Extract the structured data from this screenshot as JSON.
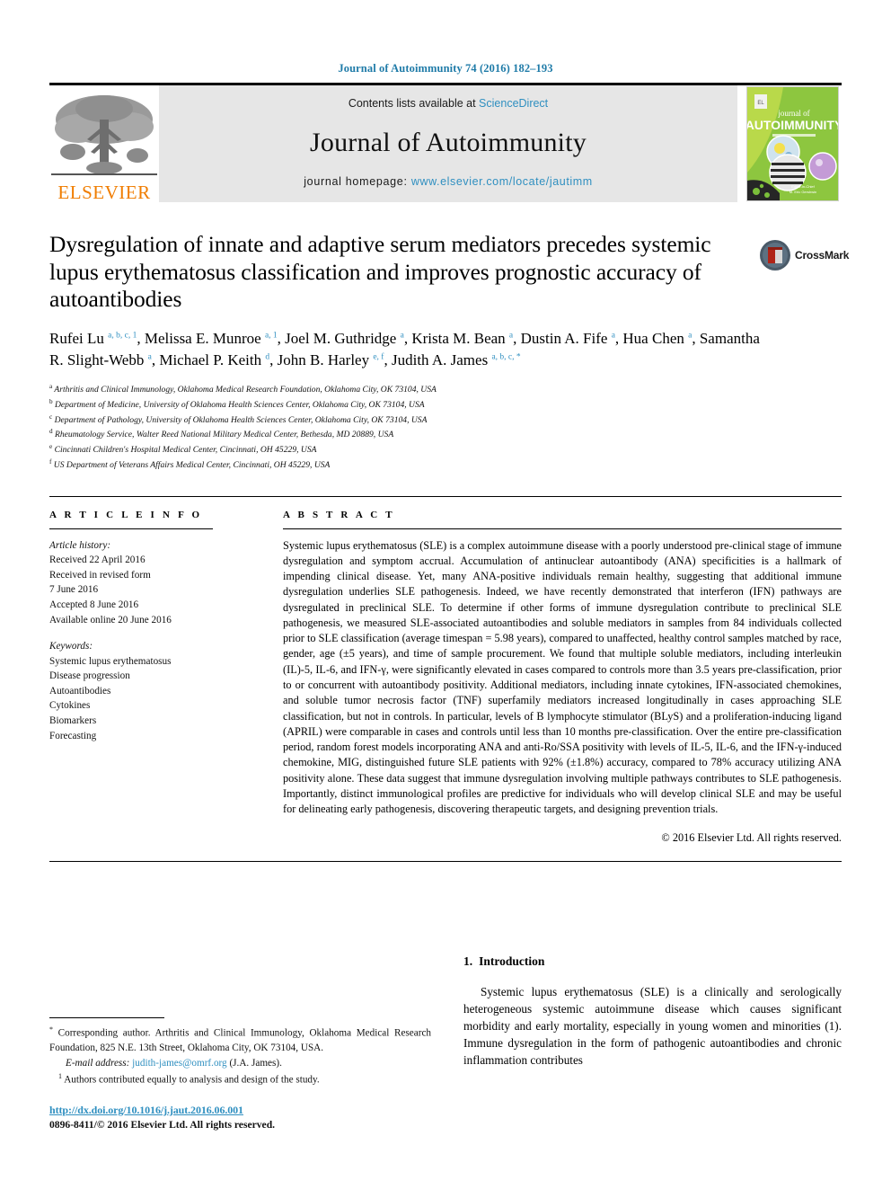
{
  "running_head": "Journal of Autoimmunity 74 (2016) 182–193",
  "masthead": {
    "publisher_name": "ELSEVIER",
    "contents_prefix": "Contents lists available at ",
    "contents_link": "ScienceDirect",
    "journal_title": "Journal of Autoimmunity",
    "homepage_prefix": "journal homepage: ",
    "homepage_link": "www.elsevier.com/locate/jautimm",
    "cover_line1": "journal of",
    "cover_line2": "AUTOIMMUNITY"
  },
  "article": {
    "title": "Dysregulation of innate and adaptive serum mediators precedes systemic lupus erythematosus classification and improves prognostic accuracy of autoantibodies",
    "crossmark_label": "CrossMark",
    "authors_html": "Rufei Lu <sup>a, b, c, 1</sup>, Melissa E. Munroe <sup>a, 1</sup>, Joel M. Guthridge <sup>a</sup>, Krista M. Bean <sup>a</sup>, Dustin A. Fife <sup>a</sup>, Hua Chen <sup>a</sup>, Samantha R. Slight-Webb <sup>a</sup>, Michael P. Keith <sup>d</sup>, John B. Harley <sup>e, f</sup>, Judith A. James <sup>a, b, c, *</sup>",
    "affiliations": [
      {
        "mark": "a",
        "text": "Arthritis and Clinical Immunology, Oklahoma Medical Research Foundation, Oklahoma City, OK 73104, USA"
      },
      {
        "mark": "b",
        "text": "Department of Medicine, University of Oklahoma Health Sciences Center, Oklahoma City, OK 73104, USA"
      },
      {
        "mark": "c",
        "text": "Department of Pathology, University of Oklahoma Health Sciences Center, Oklahoma City, OK 73104, USA"
      },
      {
        "mark": "d",
        "text": "Rheumatology Service, Walter Reed National Military Medical Center, Bethesda, MD 20889, USA"
      },
      {
        "mark": "e",
        "text": "Cincinnati Children's Hospital Medical Center, Cincinnati, OH 45229, USA"
      },
      {
        "mark": "f",
        "text": "US Department of Veterans Affairs Medical Center, Cincinnati, OH 45229, USA"
      }
    ]
  },
  "article_info": {
    "heading": "A R T I C L E  I N F O",
    "history_label": "Article history:",
    "history": [
      "Received 22 April 2016",
      "Received in revised form",
      "7 June 2016",
      "Accepted 8 June 2016",
      "Available online 20 June 2016"
    ],
    "keywords_label": "Keywords:",
    "keywords": [
      "Systemic lupus erythematosus",
      "Disease progression",
      "Autoantibodies",
      "Cytokines",
      "Biomarkers",
      "Forecasting"
    ]
  },
  "abstract": {
    "heading": "A B S T R A C T",
    "text": "Systemic lupus erythematosus (SLE) is a complex autoimmune disease with a poorly understood pre-clinical stage of immune dysregulation and symptom accrual. Accumulation of antinuclear autoantibody (ANA) specificities is a hallmark of impending clinical disease. Yet, many ANA-positive individuals remain healthy, suggesting that additional immune dysregulation underlies SLE pathogenesis. Indeed, we have recently demonstrated that interferon (IFN) pathways are dysregulated in preclinical SLE. To determine if other forms of immune dysregulation contribute to preclinical SLE pathogenesis, we measured SLE-associated autoantibodies and soluble mediators in samples from 84 individuals collected prior to SLE classification (average timespan = 5.98 years), compared to unaffected, healthy control samples matched by race, gender, age (±5 years), and time of sample procurement. We found that multiple soluble mediators, including interleukin (IL)-5, IL-6, and IFN-γ, were significantly elevated in cases compared to controls more than 3.5 years pre-classification, prior to or concurrent with autoantibody positivity. Additional mediators, including innate cytokines, IFN-associated chemokines, and soluble tumor necrosis factor (TNF) superfamily mediators increased longitudinally in cases approaching SLE classification, but not in controls. In particular, levels of B lymphocyte stimulator (BLyS) and a proliferation-inducing ligand (APRIL) were comparable in cases and controls until less than 10 months pre-classification. Over the entire pre-classification period, random forest models incorporating ANA and anti-Ro/SSA positivity with levels of IL-5, IL-6, and the IFN-γ-induced chemokine, MIG, distinguished future SLE patients with 92% (±1.8%) accuracy, compared to 78% accuracy utilizing ANA positivity alone. These data suggest that immune dysregulation involving multiple pathways contributes to SLE pathogenesis. Importantly, distinct immunological profiles are predictive for individuals who will develop clinical SLE and may be useful for delineating early pathogenesis, discovering therapeutic targets, and designing prevention trials.",
    "copyright": "© 2016 Elsevier Ltd. All rights reserved."
  },
  "introduction": {
    "number": "1.",
    "heading": "Introduction",
    "paragraph": "Systemic lupus erythematosus (SLE) is a clinically and serologically heterogeneous systemic autoimmune disease which causes significant morbidity and early mortality, especially in young women and minorities (1). Immune dysregulation in the form of pathogenic autoantibodies and chronic inflammation contributes"
  },
  "footnotes": {
    "corresponding_mark": "*",
    "corresponding_text": "Corresponding author. Arthritis and Clinical Immunology, Oklahoma Medical Research Foundation, 825 N.E. 13th Street, Oklahoma City, OK 73104, USA.",
    "email_label": "E-mail address:",
    "email_value": "judith-james@omrf.org",
    "email_attribution": "(J.A. James).",
    "equal_mark": "1",
    "equal_text": "Authors contributed equally to analysis and design of the study.",
    "doi": "http://dx.doi.org/10.1016/j.jaut.2016.06.001",
    "issn_line": "0896-8411/© 2016 Elsevier Ltd. All rights reserved."
  },
  "colors": {
    "link_blue": "#2f8fc0",
    "running_head_blue": "#1f7ba8",
    "elsevier_orange": "#f07d00",
    "masthead_grey": "#e6e6e6",
    "crossmark_red": "#b02418",
    "cover_green": "#8dc63f"
  }
}
